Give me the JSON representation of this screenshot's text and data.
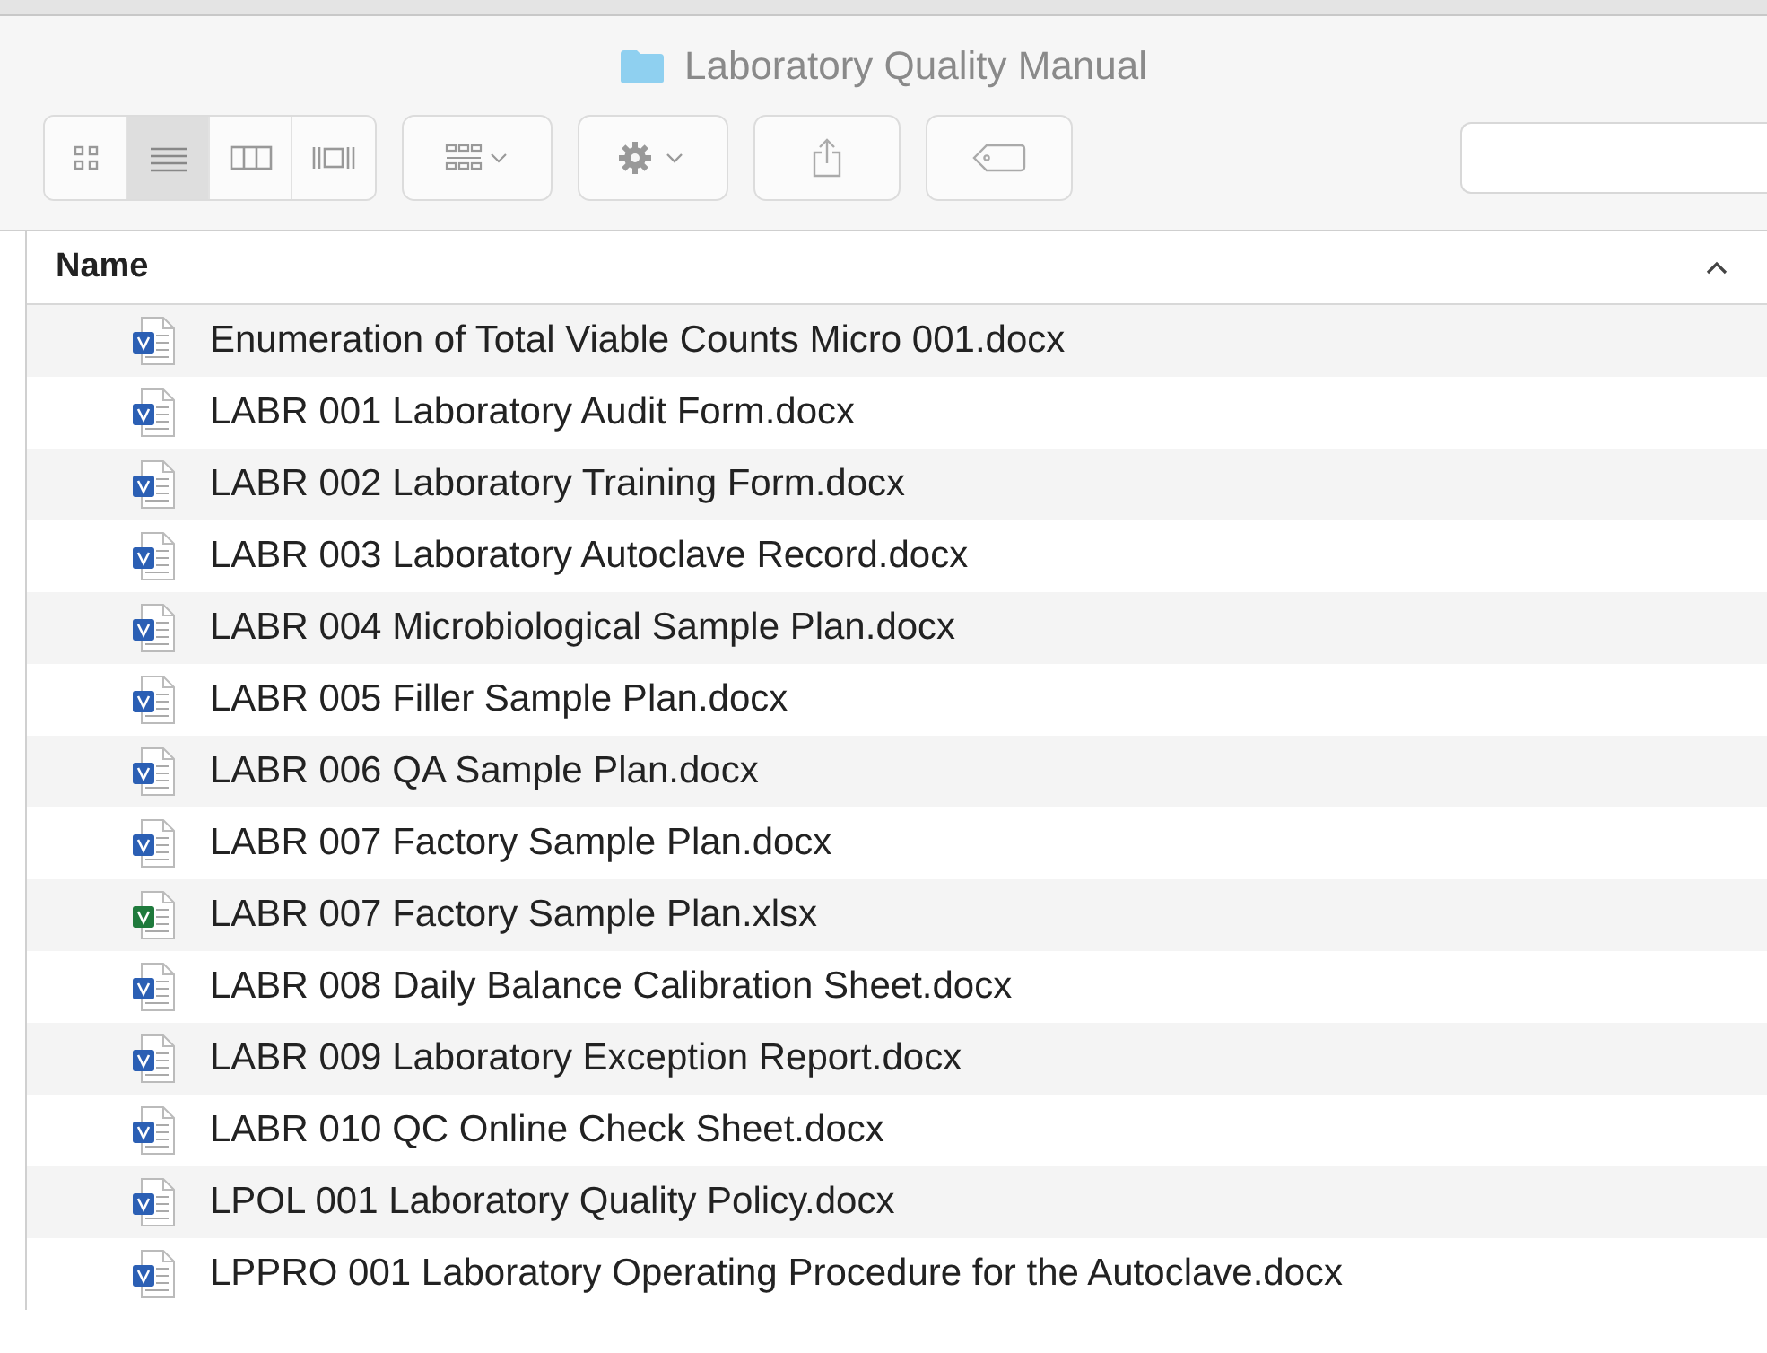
{
  "window": {
    "title": "Laboratory Quality Manual"
  },
  "toolbar": {
    "view_modes": [
      {
        "kind": "icons",
        "selected": false
      },
      {
        "kind": "list",
        "selected": true
      },
      {
        "kind": "columns",
        "selected": false
      },
      {
        "kind": "gallery",
        "selected": false
      }
    ]
  },
  "table": {
    "columns": [
      {
        "label": "Name"
      }
    ],
    "rows": [
      {
        "name": "Enumeration of Total Viable Counts Micro 001.docx",
        "kind": "word"
      },
      {
        "name": "LABR 001 Laboratory Audit Form.docx",
        "kind": "word"
      },
      {
        "name": "LABR 002 Laboratory Training Form.docx",
        "kind": "word"
      },
      {
        "name": "LABR 003 Laboratory Autoclave Record.docx",
        "kind": "word"
      },
      {
        "name": "LABR 004 Microbiological Sample Plan.docx",
        "kind": "word"
      },
      {
        "name": "LABR 005 Filler Sample Plan.docx",
        "kind": "word"
      },
      {
        "name": "LABR 006 QA Sample Plan.docx",
        "kind": "word"
      },
      {
        "name": "LABR 007 Factory Sample Plan.docx",
        "kind": "word"
      },
      {
        "name": "LABR 007 Factory Sample Plan.xlsx",
        "kind": "excel"
      },
      {
        "name": "LABR 008 Daily Balance Calibration Sheet.docx",
        "kind": "word"
      },
      {
        "name": "LABR 009 Laboratory Exception Report.docx",
        "kind": "word"
      },
      {
        "name": "LABR 010 QC Online Check Sheet.docx",
        "kind": "word"
      },
      {
        "name": "LPOL 001 Laboratory Quality Policy.docx",
        "kind": "word"
      },
      {
        "name": "LPPRO 001 Laboratory Operating Procedure for the Autoclave.docx",
        "kind": "word"
      }
    ]
  }
}
